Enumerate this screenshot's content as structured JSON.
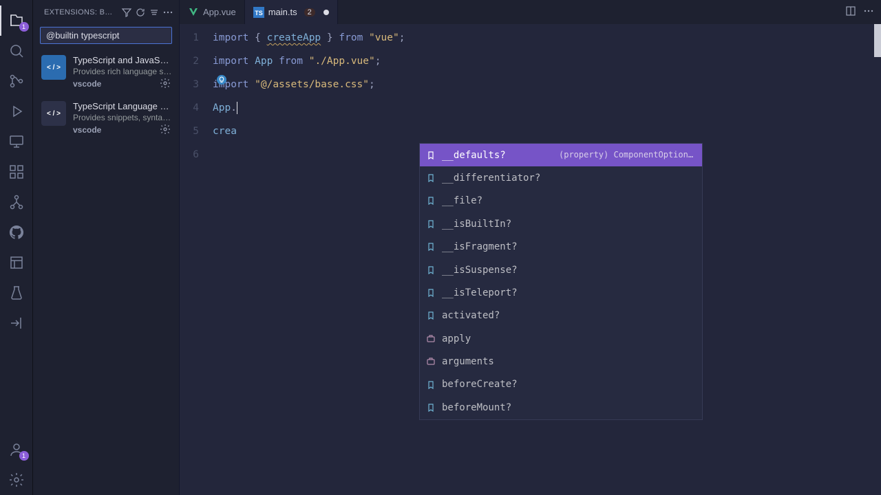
{
  "activityBar": {
    "explorerBadge": "1",
    "accountBadge": "1"
  },
  "sidebar": {
    "title": "EXTENSIONS: B…",
    "searchValue": "@builtin typescript",
    "items": [
      {
        "name": "TypeScript and JavaScri…",
        "desc": "Provides rich language sup…",
        "author": "vscode",
        "iconClass": "blue",
        "iconText": "< / >"
      },
      {
        "name": "TypeScript Language Bas…",
        "desc": "Provides snippets, syntax h…",
        "author": "vscode",
        "iconClass": "dark",
        "iconText": "< / >"
      }
    ]
  },
  "tabs": [
    {
      "label": "App.vue",
      "active": false,
      "icon": "vue"
    },
    {
      "label": "main.ts",
      "active": true,
      "icon": "ts",
      "errors": "2",
      "dirty": true
    }
  ],
  "editor": {
    "lines": [
      {
        "n": "1",
        "html": [
          {
            "t": "import",
            "c": "kw"
          },
          {
            "t": " { ",
            "c": "sym"
          },
          {
            "t": "createApp",
            "c": "fn ul"
          },
          {
            "t": " } ",
            "c": "sym"
          },
          {
            "t": "from",
            "c": "kw"
          },
          {
            "t": " ",
            "c": ""
          },
          {
            "t": "\"vue\"",
            "c": "str"
          },
          {
            "t": ";",
            "c": "sym"
          }
        ]
      },
      {
        "n": "2",
        "html": [
          {
            "t": "import",
            "c": "kw"
          },
          {
            "t": " ",
            "c": ""
          },
          {
            "t": "App",
            "c": "fn"
          },
          {
            "t": " ",
            "c": ""
          },
          {
            "t": "from",
            "c": "kw"
          },
          {
            "t": " ",
            "c": ""
          },
          {
            "t": "\"./App.vue\"",
            "c": "str"
          },
          {
            "t": ";",
            "c": "sym"
          }
        ]
      },
      {
        "n": "3",
        "html": [
          {
            "t": "import",
            "c": "kw"
          },
          {
            "t": " ",
            "c": ""
          },
          {
            "t": "\"@/assets/base.css\"",
            "c": "str"
          },
          {
            "t": ";",
            "c": "sym"
          }
        ]
      },
      {
        "n": "4",
        "html": [
          {
            "t": "App",
            "c": "fn"
          },
          {
            "t": ".",
            "c": "sym"
          }
        ]
      },
      {
        "n": "5",
        "html": [
          {
            "t": "crea",
            "c": "fn"
          }
        ]
      },
      {
        "n": "6",
        "html": []
      }
    ]
  },
  "suggest": {
    "selectedDoc": "(property) ComponentOptionsBase<Readon…",
    "items": [
      {
        "label": "__defaults?",
        "kind": "prop",
        "selected": true
      },
      {
        "label": "__differentiator?",
        "kind": "prop"
      },
      {
        "label": "__file?",
        "kind": "prop"
      },
      {
        "label": "__isBuiltIn?",
        "kind": "prop"
      },
      {
        "label": "__isFragment?",
        "kind": "prop"
      },
      {
        "label": "__isSuspense?",
        "kind": "prop"
      },
      {
        "label": "__isTeleport?",
        "kind": "prop"
      },
      {
        "label": "activated?",
        "kind": "prop"
      },
      {
        "label": "apply",
        "kind": "method"
      },
      {
        "label": "arguments",
        "kind": "method"
      },
      {
        "label": "beforeCreate?",
        "kind": "prop"
      },
      {
        "label": "beforeMount?",
        "kind": "prop"
      }
    ]
  }
}
